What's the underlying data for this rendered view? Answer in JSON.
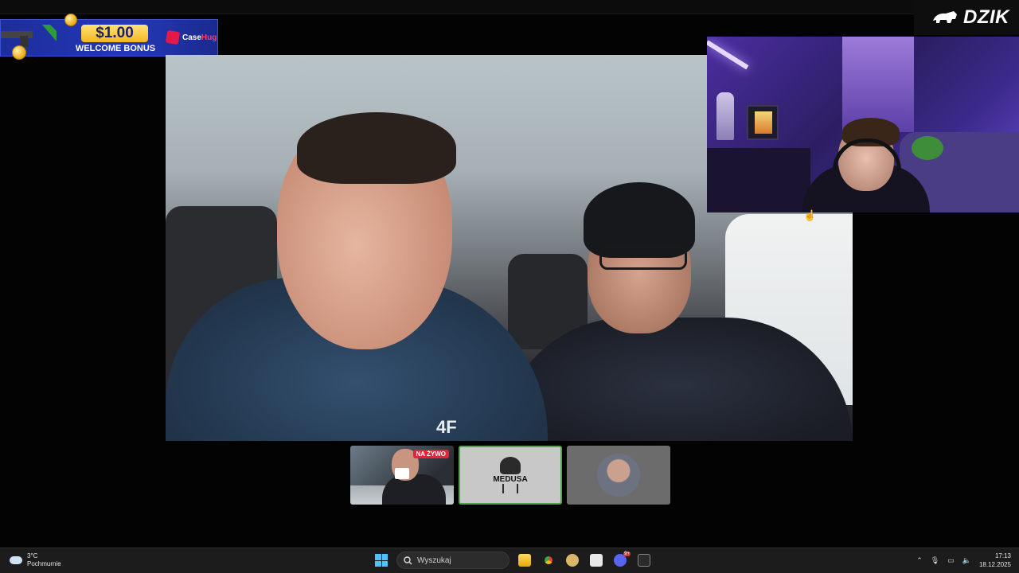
{
  "ad": {
    "amount": "$1.00",
    "bonus_text": "WELCOME BONUS",
    "brand_a": "Case",
    "brand_b": "Hug"
  },
  "brand": {
    "name": "DZIK"
  },
  "main_video": {
    "logo_on_jacket": "4F"
  },
  "thumbnails": [
    {
      "badge": "NA ŻYWO"
    },
    {
      "label": "MEDUSA"
    },
    {
      "label": ""
    }
  ],
  "taskbar": {
    "weather_temp": "3°C",
    "weather_desc": "Pochmurnie",
    "search_placeholder": "Wyszukaj",
    "time": "17:13",
    "date": "18.12.2025",
    "notification_count": "9+"
  },
  "colors": {
    "accent_blue": "#4cc2ff",
    "live_red": "#e3253b",
    "selected_border": "#5a9e55"
  }
}
